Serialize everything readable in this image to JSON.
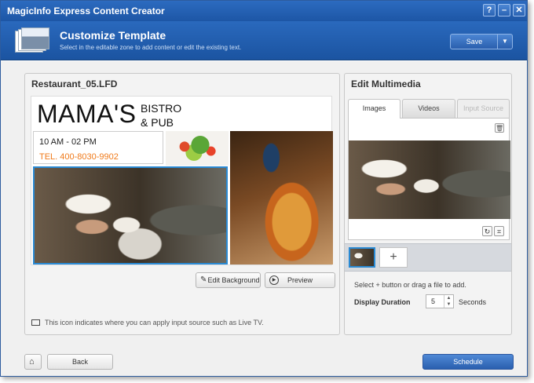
{
  "window": {
    "title": "MagicInfo Express Content Creator",
    "controls": [
      "?",
      "–",
      "✕"
    ]
  },
  "header": {
    "title": "Customize Template",
    "subtitle": "Select in the editable zone to add content or edit the existing text.",
    "save_label": "Save",
    "save_caret": "▼"
  },
  "editor": {
    "file_name": "Restaurant_05.LFD",
    "template": {
      "brand": "MAMA'S",
      "brand_sub_1": "BISTRO",
      "brand_sub_2": "& PUB",
      "hours": "10 AM - 02 PM",
      "tel": "TEL. 400-8030-9902"
    },
    "edit_background_label": "Edit Background",
    "preview_label": "Preview",
    "note": "This icon indicates where you can apply input source such as Live TV."
  },
  "multimedia": {
    "title": "Edit Multimedia",
    "tabs": [
      {
        "label": "Images",
        "state": "active"
      },
      {
        "label": "Videos",
        "state": "inactive"
      },
      {
        "label": "Input Source",
        "state": "disabled"
      }
    ],
    "add_label": "+",
    "hint": "Select + button or drag a file to add.",
    "duration_label": "Display Duration",
    "duration_value": "5",
    "duration_unit": "Seconds"
  },
  "footer": {
    "back_label": "Back",
    "schedule_label": "Schedule"
  },
  "colors": {
    "accent_blue": "#1d56a6",
    "selection_blue": "#2a8ad4",
    "phone_orange": "#f07a1a"
  }
}
